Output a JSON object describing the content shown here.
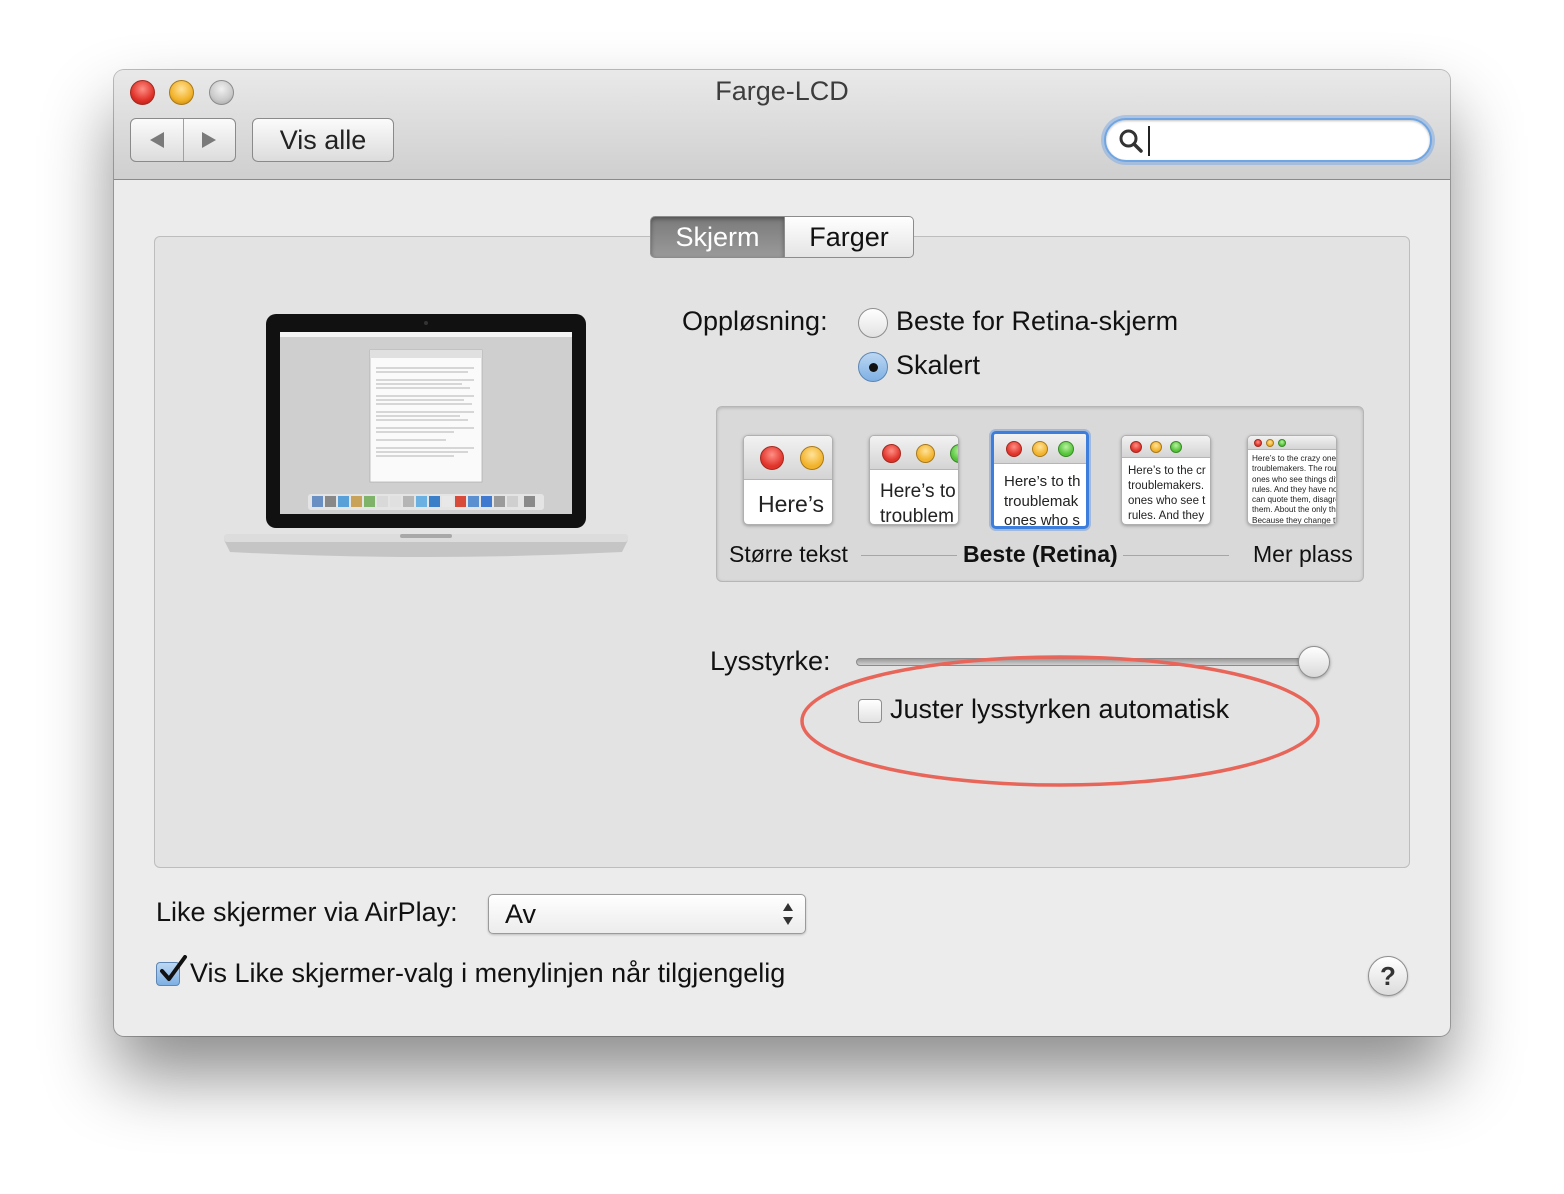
{
  "window": {
    "title": "Farge-LCD"
  },
  "toolbar": {
    "show_all_label": "Vis alle",
    "search_placeholder": "",
    "search_value": ""
  },
  "tabs": [
    {
      "label": "Skjerm",
      "active": true
    },
    {
      "label": "Farger",
      "active": false
    }
  ],
  "resolution": {
    "label": "Oppløsning:",
    "options": [
      {
        "label": "Beste for Retina-skjerm",
        "selected": false
      },
      {
        "label": "Skalert",
        "selected": true
      }
    ],
    "scaled_options": [
      {
        "preview_text": "Here’s",
        "selected": false
      },
      {
        "preview_text": "Here’s to\ntroublem",
        "selected": false
      },
      {
        "preview_text": "Here’s to th\ntroublemak\nones who s",
        "selected": true
      },
      {
        "preview_text": "Here’s to the cr\ntroublemakers.\nones who see t\nrules. And they",
        "selected": false
      },
      {
        "preview_text": "Here’s to the crazy ones\ntroublemakers. The rou\nones who see things dif\nrules. And they have no\ncan quote them, disagre\nthem. About the only th\nBecause they change th",
        "selected": false
      }
    ],
    "scale_labels": {
      "larger_text": "Større tekst",
      "best": "Beste (Retina)",
      "more_space": "Mer plass"
    }
  },
  "brightness": {
    "label": "Lysstyrke:",
    "value": 1.0,
    "auto_label": "Juster lysstyrken automatisk",
    "auto_checked": false
  },
  "airplay": {
    "label": "Like skjermer via AirPlay:",
    "value": "Av",
    "show_in_menu_label": "Vis Like skjermer-valg i menylinjen når tilgjengelig",
    "show_in_menu_checked": true
  },
  "help_label": "?",
  "colors": {
    "accent": "#3d7ddb",
    "highlight": "#e8655a"
  }
}
